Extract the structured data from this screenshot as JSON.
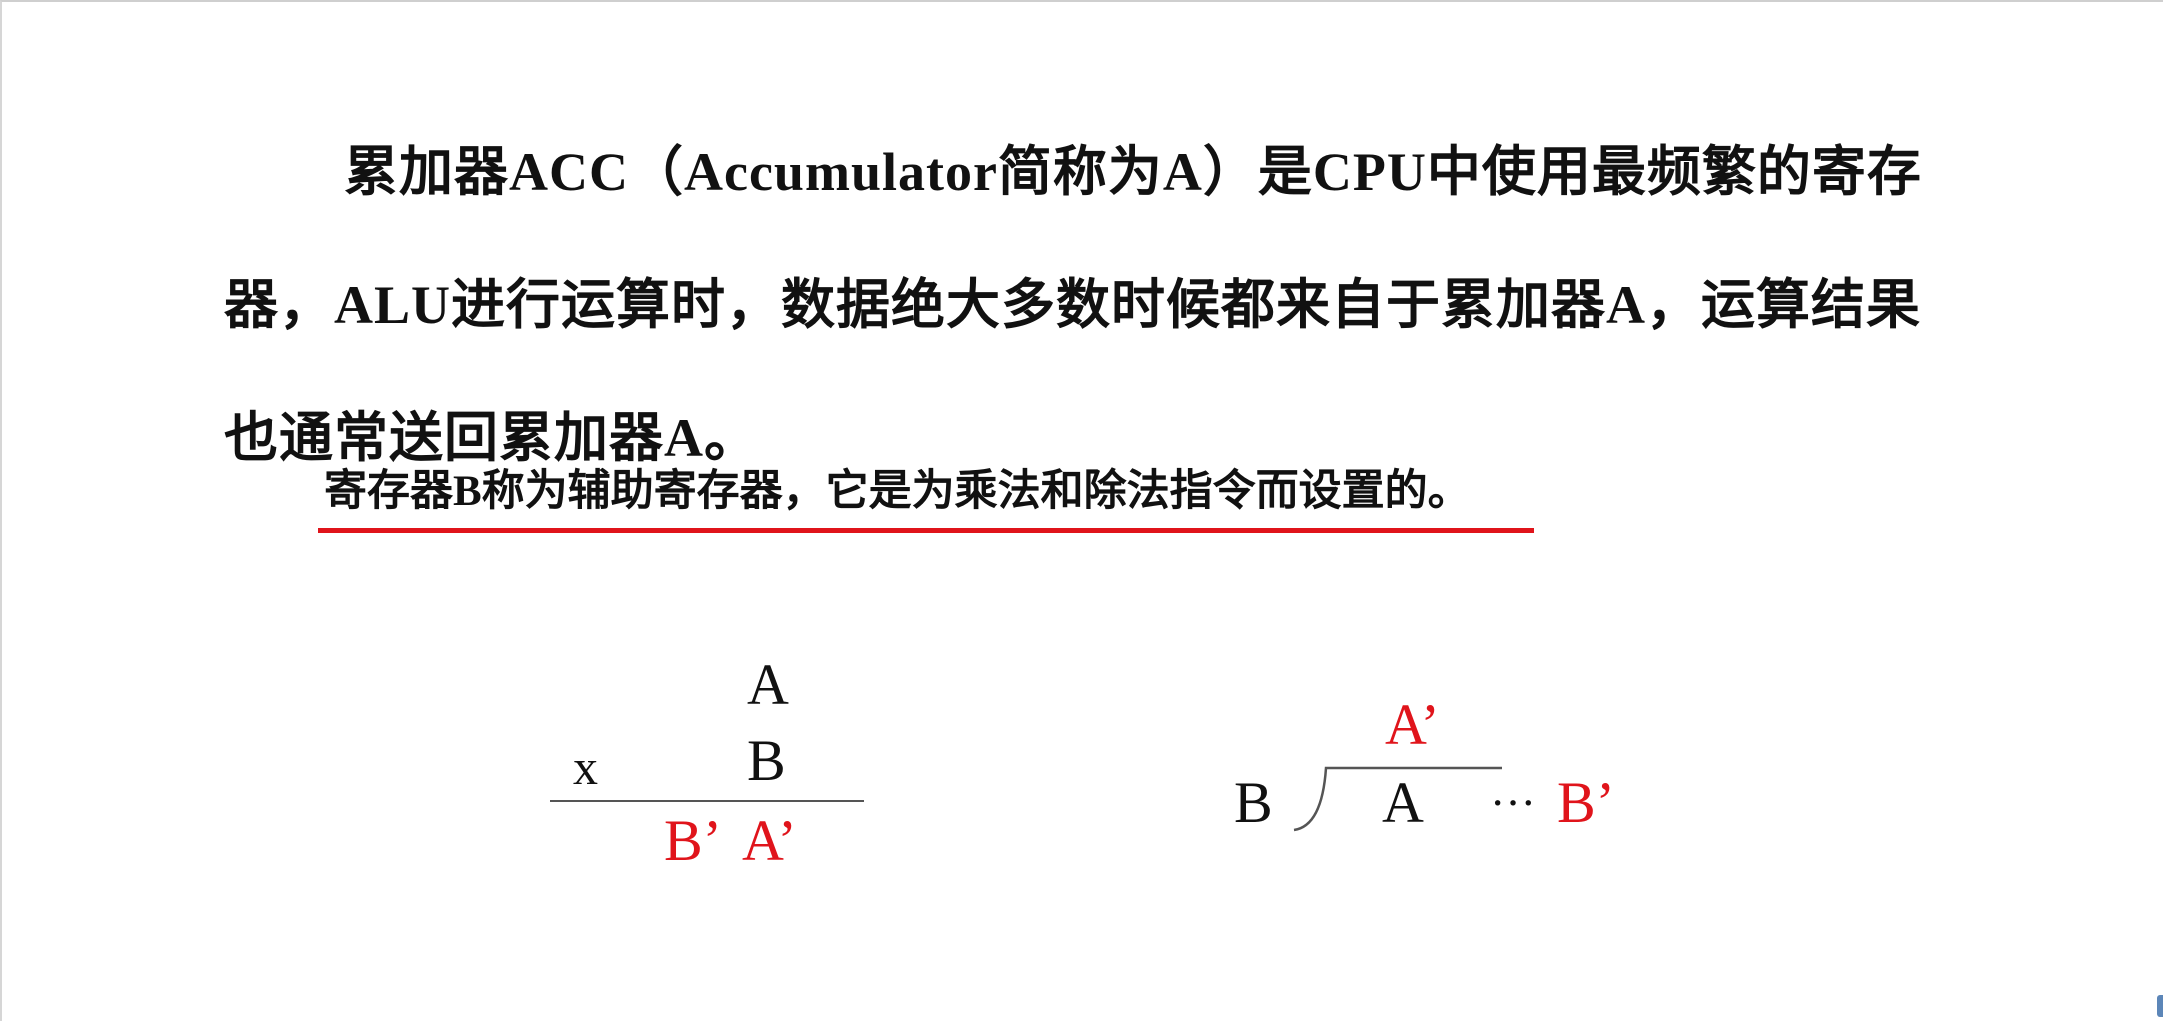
{
  "paragraph": "累加器ACC（Accumulator简称为A）是CPU中使用最频繁的寄存器，ALU进行运算时，数据绝大多数时候都来自于累加器A，运算结果也通常送回累加器A。",
  "note": "寄存器B称为辅助寄存器，它是为乘法和除法指令而设置的。",
  "colors": {
    "accent_red": "#e0141b",
    "text": "#111111"
  },
  "multiplication": {
    "multiplicand": "A",
    "operator": "x",
    "multiplier": "B",
    "result_high": "B’",
    "result_low": "A’"
  },
  "division": {
    "divisor": "B",
    "dividend": "A",
    "quotient": "A’",
    "ellipsis": "···",
    "remainder": "B’"
  }
}
